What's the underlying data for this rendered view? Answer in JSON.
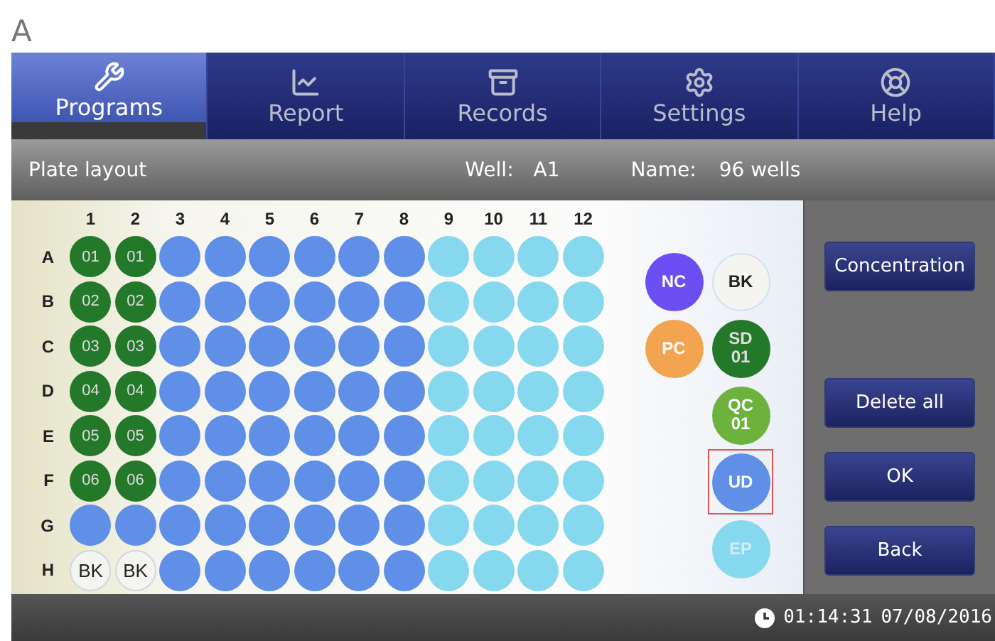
{
  "panel_label": "A",
  "tabs": [
    {
      "label": "Programs",
      "selected": true
    },
    {
      "label": "Report",
      "selected": false
    },
    {
      "label": "Records",
      "selected": false
    },
    {
      "label": "Settings",
      "selected": false
    },
    {
      "label": "Help",
      "selected": false
    }
  ],
  "header": {
    "title": "Plate layout",
    "well_label": "Well:",
    "well": "A1",
    "name_label": "Name:",
    "name": "96 wells"
  },
  "plate": {
    "columns": [
      "1",
      "2",
      "3",
      "4",
      "5",
      "6",
      "7",
      "8",
      "9",
      "10",
      "11",
      "12"
    ],
    "rows": [
      {
        "label": "A",
        "wells": [
          {
            "kind": "sd",
            "label": "01"
          },
          {
            "kind": "sd",
            "label": "01"
          },
          {
            "kind": "ud"
          },
          {
            "kind": "ud"
          },
          {
            "kind": "ud"
          },
          {
            "kind": "ud"
          },
          {
            "kind": "ud"
          },
          {
            "kind": "ud"
          },
          {
            "kind": "ep"
          },
          {
            "kind": "ep"
          },
          {
            "kind": "ep"
          },
          {
            "kind": "ep"
          }
        ]
      },
      {
        "label": "B",
        "wells": [
          {
            "kind": "sd",
            "label": "02"
          },
          {
            "kind": "sd",
            "label": "02"
          },
          {
            "kind": "ud"
          },
          {
            "kind": "ud"
          },
          {
            "kind": "ud"
          },
          {
            "kind": "ud"
          },
          {
            "kind": "ud"
          },
          {
            "kind": "ud"
          },
          {
            "kind": "ep"
          },
          {
            "kind": "ep"
          },
          {
            "kind": "ep"
          },
          {
            "kind": "ep"
          }
        ]
      },
      {
        "label": "C",
        "wells": [
          {
            "kind": "sd",
            "label": "03"
          },
          {
            "kind": "sd",
            "label": "03"
          },
          {
            "kind": "ud"
          },
          {
            "kind": "ud"
          },
          {
            "kind": "ud"
          },
          {
            "kind": "ud"
          },
          {
            "kind": "ud"
          },
          {
            "kind": "ud"
          },
          {
            "kind": "ep"
          },
          {
            "kind": "ep"
          },
          {
            "kind": "ep"
          },
          {
            "kind": "ep"
          }
        ]
      },
      {
        "label": "D",
        "wells": [
          {
            "kind": "sd",
            "label": "04"
          },
          {
            "kind": "sd",
            "label": "04"
          },
          {
            "kind": "ud"
          },
          {
            "kind": "ud"
          },
          {
            "kind": "ud"
          },
          {
            "kind": "ud"
          },
          {
            "kind": "ud"
          },
          {
            "kind": "ud"
          },
          {
            "kind": "ep"
          },
          {
            "kind": "ep"
          },
          {
            "kind": "ep"
          },
          {
            "kind": "ep"
          }
        ]
      },
      {
        "label": "E",
        "wells": [
          {
            "kind": "sd",
            "label": "05"
          },
          {
            "kind": "sd",
            "label": "05"
          },
          {
            "kind": "ud"
          },
          {
            "kind": "ud"
          },
          {
            "kind": "ud"
          },
          {
            "kind": "ud"
          },
          {
            "kind": "ud"
          },
          {
            "kind": "ud"
          },
          {
            "kind": "ep"
          },
          {
            "kind": "ep"
          },
          {
            "kind": "ep"
          },
          {
            "kind": "ep"
          }
        ]
      },
      {
        "label": "F",
        "wells": [
          {
            "kind": "sd",
            "label": "06"
          },
          {
            "kind": "sd",
            "label": "06"
          },
          {
            "kind": "ud"
          },
          {
            "kind": "ud"
          },
          {
            "kind": "ud"
          },
          {
            "kind": "ud"
          },
          {
            "kind": "ud"
          },
          {
            "kind": "ud"
          },
          {
            "kind": "ep"
          },
          {
            "kind": "ep"
          },
          {
            "kind": "ep"
          },
          {
            "kind": "ep"
          }
        ]
      },
      {
        "label": "G",
        "wells": [
          {
            "kind": "ud"
          },
          {
            "kind": "ud"
          },
          {
            "kind": "ud"
          },
          {
            "kind": "ud"
          },
          {
            "kind": "ud"
          },
          {
            "kind": "ud"
          },
          {
            "kind": "ud"
          },
          {
            "kind": "ud"
          },
          {
            "kind": "ep"
          },
          {
            "kind": "ep"
          },
          {
            "kind": "ep"
          },
          {
            "kind": "ep"
          }
        ]
      },
      {
        "label": "H",
        "wells": [
          {
            "kind": "bk",
            "label": "BK"
          },
          {
            "kind": "bk",
            "label": "BK"
          },
          {
            "kind": "ud"
          },
          {
            "kind": "ud"
          },
          {
            "kind": "ud"
          },
          {
            "kind": "ud"
          },
          {
            "kind": "ud"
          },
          {
            "kind": "ud"
          },
          {
            "kind": "ep"
          },
          {
            "kind": "ep"
          },
          {
            "kind": "ep"
          },
          {
            "kind": "ep"
          }
        ]
      }
    ]
  },
  "legend": {
    "left": [
      {
        "kind": "nc",
        "label": "NC",
        "selected": false
      },
      {
        "kind": "pc",
        "label": "PC",
        "selected": false
      }
    ],
    "right": [
      {
        "kind": "bk",
        "label": "BK",
        "selected": false
      },
      {
        "kind": "sd",
        "label": "SD 01",
        "selected": false
      },
      {
        "kind": "qc",
        "label": "QC 01",
        "selected": false
      },
      {
        "kind": "ud",
        "label": "UD",
        "selected": true
      },
      {
        "kind": "ep",
        "label": "EP",
        "selected": false
      }
    ]
  },
  "buttons": [
    {
      "label": "Concentration",
      "kind": "top"
    },
    {
      "label": "Delete all",
      "kind": "bottom"
    },
    {
      "label": "OK",
      "kind": "bottom"
    },
    {
      "label": "Back",
      "kind": "bottom"
    }
  ],
  "status": {
    "time": "01:14:31",
    "date": "07/08/2016"
  }
}
